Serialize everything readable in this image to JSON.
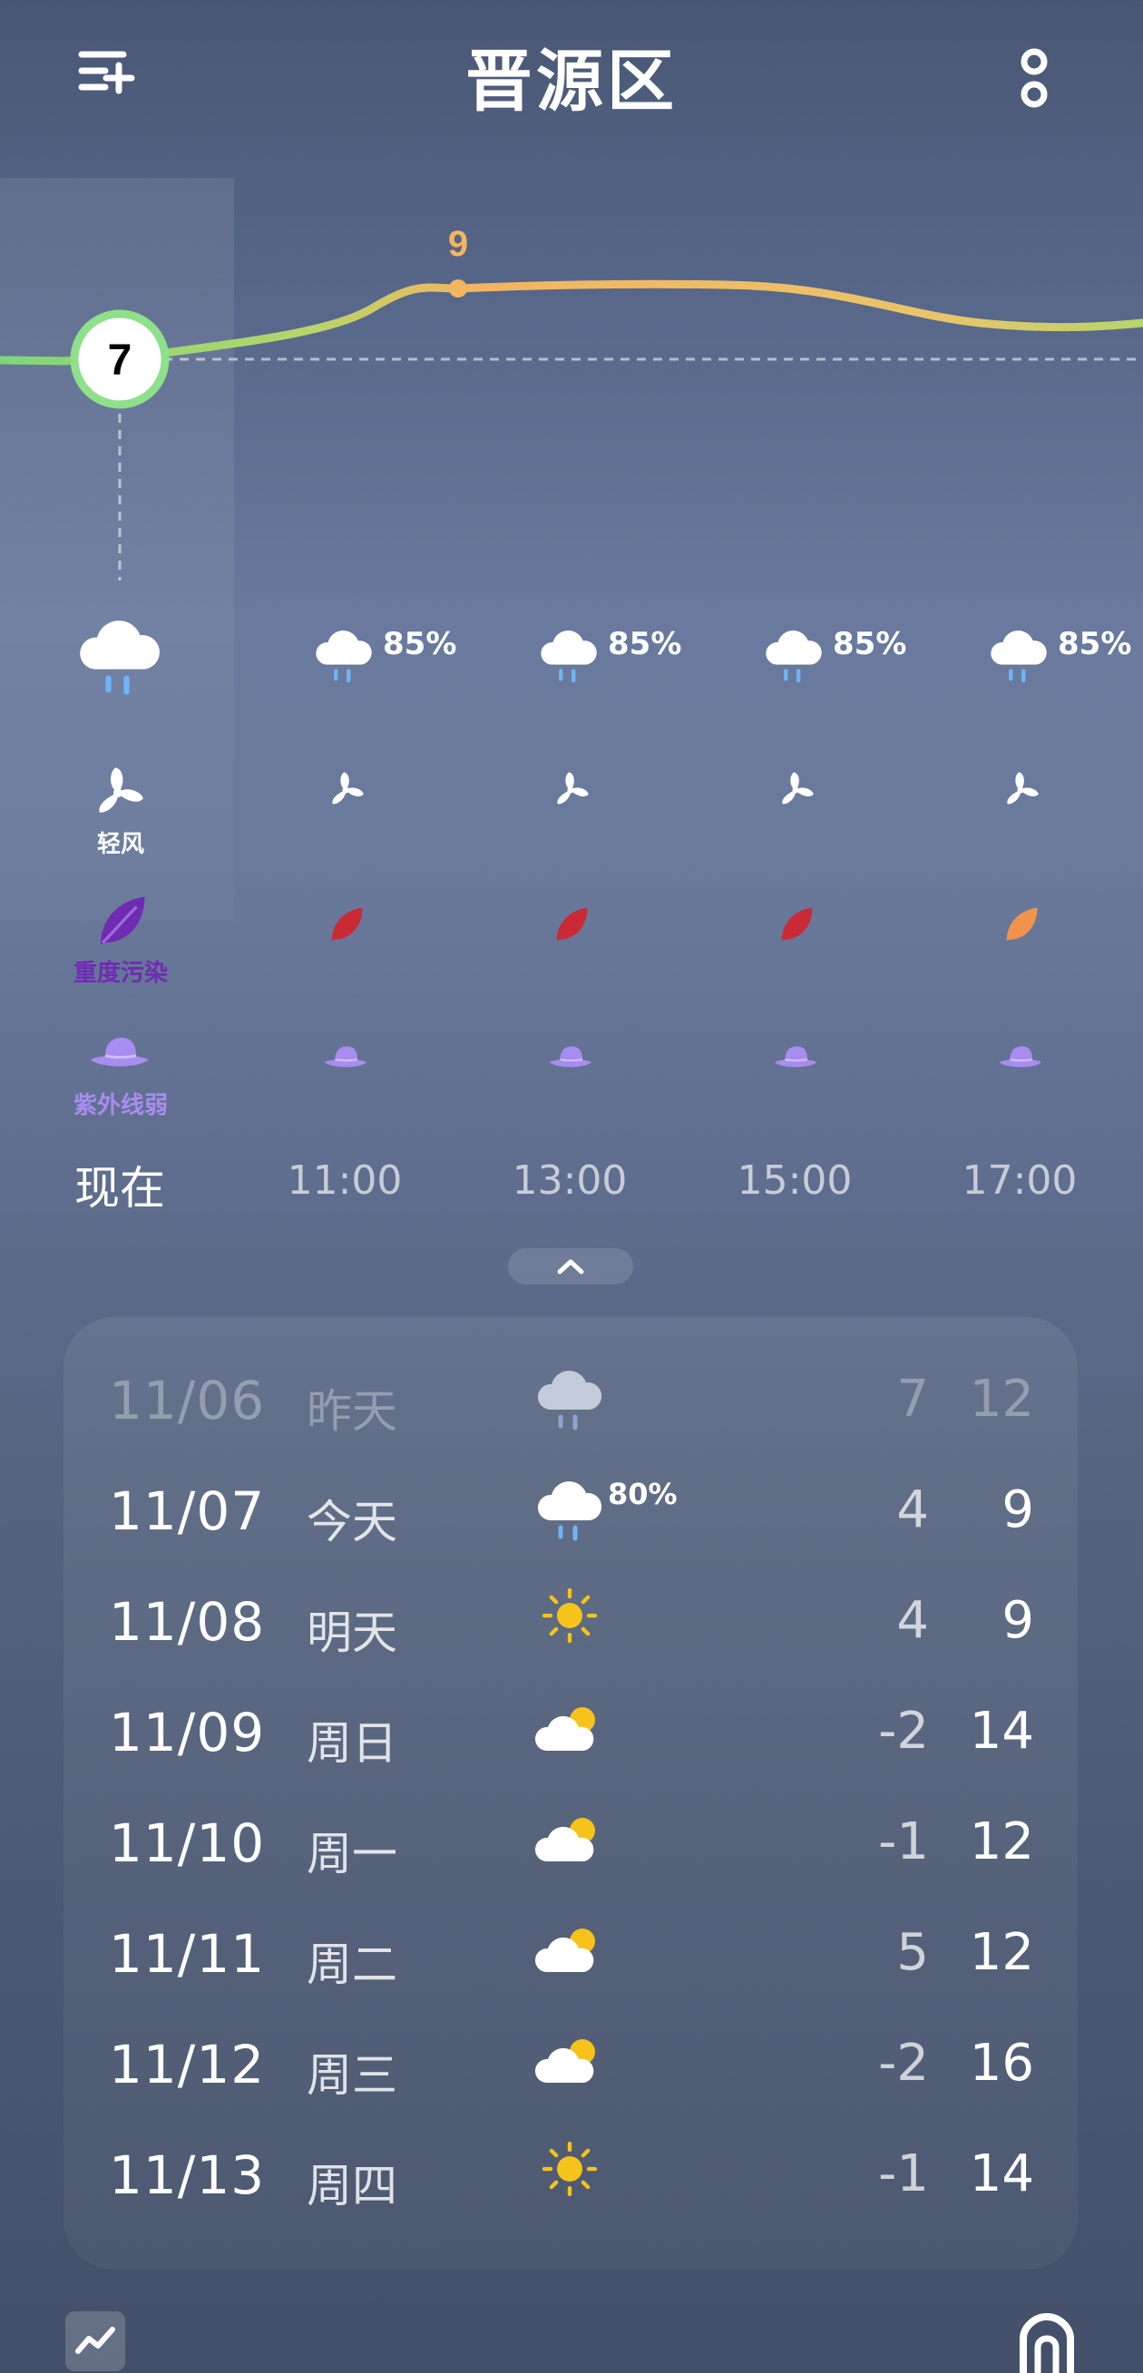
{
  "header": {
    "location": "晋源区",
    "menu_icon": "add-location-list-icon",
    "more_icon": "more-vertical-icon"
  },
  "hourly": {
    "current_temp": "7",
    "peak_temp_label": "9",
    "current": {
      "label": "现在",
      "weather_icon": "rain-cloud-icon",
      "wind_label": "轻风",
      "aqi_label": "重度污染",
      "uv_label": "紫外线弱"
    },
    "slots": [
      {
        "time": "11:00",
        "precip": "85%",
        "weather_icon": "rain-cloud-icon",
        "aqi_color": "#c92a35"
      },
      {
        "time": "13:00",
        "precip": "85%",
        "weather_icon": "rain-cloud-icon",
        "aqi_color": "#c92a35"
      },
      {
        "time": "15:00",
        "precip": "85%",
        "weather_icon": "rain-cloud-icon",
        "aqi_color": "#c92a35"
      },
      {
        "time": "17:00",
        "precip": "85%",
        "weather_icon": "rain-cloud-icon",
        "aqi_color": "#f0944c"
      }
    ]
  },
  "daily": [
    {
      "date": "11/06",
      "day": "昨天",
      "icon": "rain-cloud-icon",
      "precip": "",
      "low": "7",
      "high": "12"
    },
    {
      "date": "11/07",
      "day": "今天",
      "icon": "rain-cloud-icon",
      "precip": "80%",
      "low": "4",
      "high": "9"
    },
    {
      "date": "11/08",
      "day": "明天",
      "icon": "sun-icon",
      "precip": "",
      "low": "4",
      "high": "9"
    },
    {
      "date": "11/09",
      "day": "周日",
      "icon": "partly-cloudy-icon",
      "precip": "",
      "low": "-2",
      "high": "14"
    },
    {
      "date": "11/10",
      "day": "周一",
      "icon": "partly-cloudy-icon",
      "precip": "",
      "low": "-1",
      "high": "12"
    },
    {
      "date": "11/11",
      "day": "周二",
      "icon": "partly-cloudy-icon",
      "precip": "",
      "low": "5",
      "high": "12"
    },
    {
      "date": "11/12",
      "day": "周三",
      "icon": "partly-cloudy-icon",
      "precip": "",
      "low": "-2",
      "high": "16"
    },
    {
      "date": "11/13",
      "day": "周四",
      "icon": "sun-icon",
      "precip": "",
      "low": "-1",
      "high": "14"
    }
  ],
  "colors": {
    "temp_line_cool": "#7ed67a",
    "temp_line_warm": "#f3b560",
    "aqi_severe": "#6f2bb4",
    "uv_weak": "#a88cef",
    "sun": "#f5c31a"
  },
  "footer": {
    "left_icon": "trend-chart-icon",
    "right_icon": "home-icon"
  }
}
